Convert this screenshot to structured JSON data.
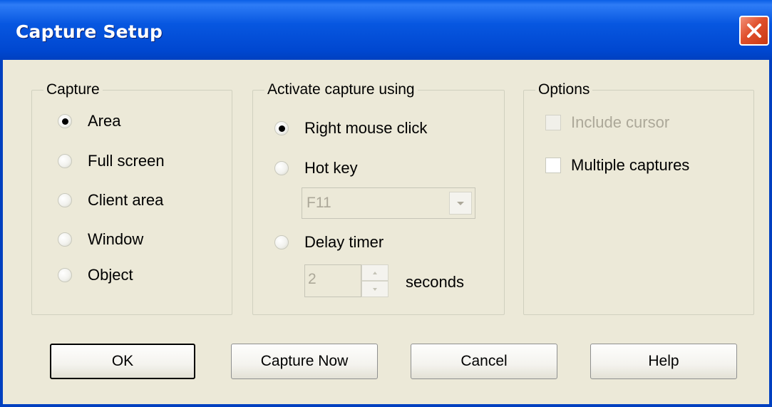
{
  "window": {
    "title": "Capture Setup"
  },
  "capture_group": {
    "label": "Capture",
    "options": [
      {
        "label": "Area",
        "selected": true
      },
      {
        "label": "Full screen",
        "selected": false
      },
      {
        "label": "Client area",
        "selected": false
      },
      {
        "label": "Window",
        "selected": false
      },
      {
        "label": "Object",
        "selected": false
      }
    ]
  },
  "activate_group": {
    "label": "Activate capture using",
    "right_click_label": "Right mouse click",
    "right_click_selected": true,
    "hot_key_label": "Hot key",
    "hot_key_selected": false,
    "hot_key_value": "F11",
    "delay_timer_label": "Delay timer",
    "delay_timer_selected": false,
    "delay_value": "2",
    "delay_unit": "seconds"
  },
  "options_group": {
    "label": "Options",
    "include_cursor_label": "Include cursor",
    "include_cursor_checked": false,
    "include_cursor_enabled": false,
    "multiple_captures_label": "Multiple captures",
    "multiple_captures_checked": false
  },
  "buttons": {
    "ok": "OK",
    "capture_now": "Capture Now",
    "cancel": "Cancel",
    "help": "Help"
  },
  "colors": {
    "titlebar": "#0054e3",
    "dialog_bg": "#ece9d8",
    "close_button": "#e0502c",
    "disabled_text": "#aca899"
  }
}
